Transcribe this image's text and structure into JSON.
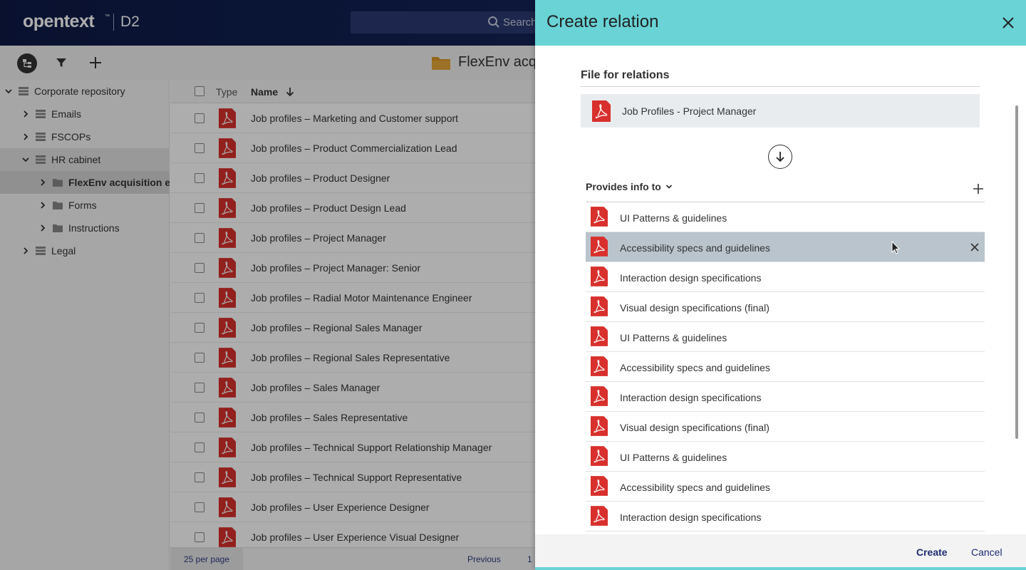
{
  "app": {
    "logo": "opentext",
    "logo_tm": "™",
    "product": "D2",
    "search_placeholder": "Search"
  },
  "toolbar": {
    "folder_title": "FlexEnv acq"
  },
  "sidebar": {
    "items": [
      {
        "label": "Corporate repository",
        "level": 0,
        "expanded": true
      },
      {
        "label": "Emails",
        "level": 1,
        "expanded": false
      },
      {
        "label": "FSCOPs",
        "level": 1,
        "expanded": false
      },
      {
        "label": "HR cabinet",
        "level": 1,
        "expanded": true
      },
      {
        "label": "FlexEnv acquisition exp",
        "level": 2,
        "expanded": false
      },
      {
        "label": "Forms",
        "level": 2,
        "expanded": false
      },
      {
        "label": "Instructions",
        "level": 2,
        "expanded": false
      },
      {
        "label": "Legal",
        "level": 1,
        "expanded": false
      }
    ]
  },
  "list": {
    "header_type": "Type",
    "header_name": "Name",
    "rows": [
      "Job profiles – Marketing and Customer support",
      "Job profiles – Product Commercialization Lead",
      "Job profiles – Product Designer",
      "Job profiles – Product Design Lead",
      "Job profiles – Project Manager",
      "Job profiles – Project Manager: Senior",
      "Job profiles – Radial Motor Maintenance Engineer",
      "Job profiles – Regional Sales Manager",
      "Job profiles – Regional Sales Representative",
      "Job profiles – Sales Manager",
      "Job profiles – Sales Representative",
      "Job profiles – Technical Support Relationship Manager",
      "Job profiles – Technical Support Representative",
      "Job profiles – User Experience Designer",
      "Job profiles – User Experience Visual Designer"
    ],
    "per_page": "25 per page",
    "previous": "Previous",
    "page": "1"
  },
  "dialog": {
    "title": "Create relation",
    "section_title": "File for relations",
    "source_file": "Job Profiles - Project Manager",
    "relation_type": "Provides info to",
    "related_files": [
      "UI Patterns & guidelines",
      "Accessibility specs and guidelines",
      "Interaction design specifications",
      "Visual design specifications (final)",
      "UI Patterns & guidelines",
      "Accessibility specs and guidelines",
      "Interaction design specifications",
      "Visual design specifications (final)",
      "UI Patterns & guidelines",
      "Accessibility specs and guidelines",
      "Interaction design specifications"
    ],
    "hovered_index": 1,
    "create_label": "Create",
    "cancel_label": "Cancel"
  },
  "colors": {
    "header_dark": "#0e1a46",
    "dialog_accent": "#69d3d6",
    "pdf_red": "#d8302c",
    "link_blue": "#1f2c72"
  }
}
